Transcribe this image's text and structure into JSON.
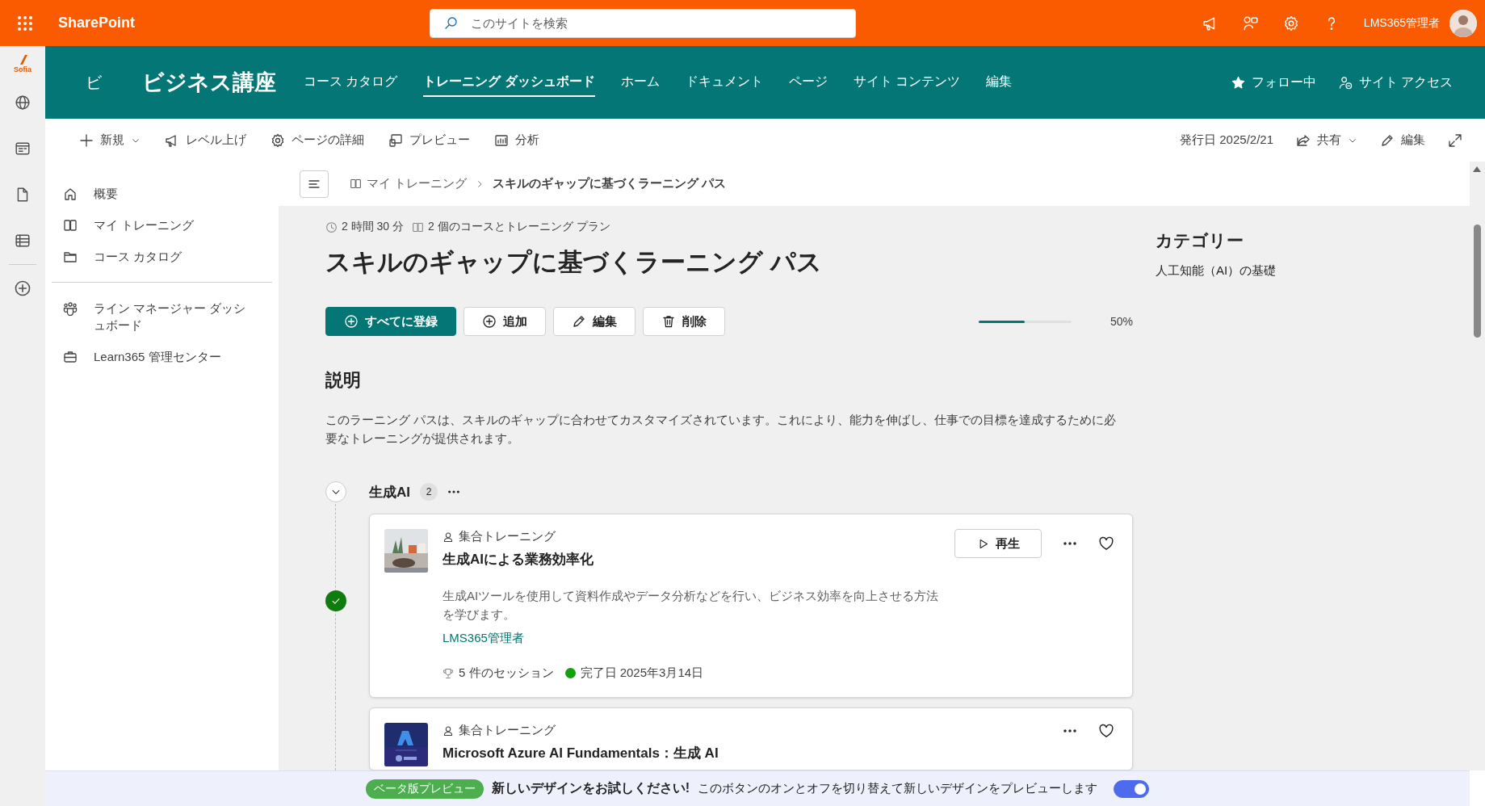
{
  "suite_bar": {
    "app_name": "SharePoint",
    "search": {
      "placeholder": "このサイトを検索"
    },
    "user_name": "LMS365管理者"
  },
  "app_rail": {
    "logo": "Sofia"
  },
  "site_header": {
    "initial": "ビ",
    "title": "ビジネス講座",
    "nav": [
      {
        "label": "コース カタログ",
        "selected": false
      },
      {
        "label": "トレーニング ダッシュボード",
        "selected": true
      },
      {
        "label": "ホーム",
        "selected": false
      },
      {
        "label": "ドキュメント",
        "selected": false
      },
      {
        "label": "ページ",
        "selected": false
      },
      {
        "label": "サイト コンテンツ",
        "selected": false
      },
      {
        "label": "編集",
        "selected": false
      }
    ],
    "follow": "フォロー中",
    "site_access": "サイト アクセス"
  },
  "command_bar": {
    "commands": [
      {
        "kind": "new",
        "label": "新規"
      },
      {
        "kind": "promote",
        "label": "レベル上げ"
      },
      {
        "kind": "details",
        "label": "ページの詳細"
      },
      {
        "kind": "preview",
        "label": "プレビュー"
      },
      {
        "kind": "analytics",
        "label": "分析"
      }
    ],
    "published": "発行日 2025/2/21",
    "share": "共有",
    "edit": "編集"
  },
  "left_nav": {
    "groups": [
      [
        {
          "kind": "home",
          "label": "概要"
        },
        {
          "kind": "book",
          "label": "マイ トレーニング"
        },
        {
          "kind": "folder",
          "label": "コース カタログ"
        }
      ],
      [
        {
          "kind": "people",
          "label": "ライン マネージャー ダッシュボード"
        },
        {
          "kind": "briefcase",
          "label": "Learn365 管理センター"
        }
      ]
    ]
  },
  "breadcrumb": [
    "マイ トレーニング",
    "スキルのギャップに基づくラーニング パス"
  ],
  "learning_path": {
    "duration": "2 時間 30 分",
    "contents": "2 個のコースとトレーニング プラン",
    "title": "スキルのギャップに基づくラーニング パス",
    "actions": [
      {
        "kind": "enroll",
        "label": "すべてに登録"
      },
      {
        "kind": "add",
        "label": "追加"
      },
      {
        "kind": "edit",
        "label": "編集"
      },
      {
        "kind": "delete",
        "label": "削除"
      }
    ],
    "progress": {
      "level": 0.5,
      "reading": "50%"
    },
    "description": {
      "heading": "説明",
      "text": "このラーニング パスは、スキルのギャップに合わせてカスタマイズされています。これにより、能力を伸ばし、仕事での目標を達成するために必要なトレーニングが提供されます。"
    }
  },
  "category": {
    "heading": "カテゴリー",
    "value": "人工知能（AI）の基礎"
  },
  "section": {
    "title": "生成AI",
    "count": "2",
    "expanded": true,
    "courses": [
      {
        "type": "集合トレーニング",
        "title": "生成AIによる業務効率化",
        "play": "再生",
        "completed": true,
        "description": "生成AIツールを使用して資料作成やデータ分析などを行い、ビジネス効率を向上させる方法を学びます。",
        "author": "LMS365管理者",
        "sessions": "5 件のセッション",
        "completed_on": "完了日 2025年3月14日"
      },
      {
        "type": "集合トレーニング",
        "title": "Microsoft Azure AI Fundamentals：生成 AI",
        "completed": false
      }
    ]
  },
  "banner": {
    "badge": "ベータ版プレビュー",
    "headline": "新しいデザインをお試しください!",
    "text": "このボタンのオンとオフを切り替えて新しいデザインをプレビューします",
    "toggle": {
      "on": true
    }
  }
}
